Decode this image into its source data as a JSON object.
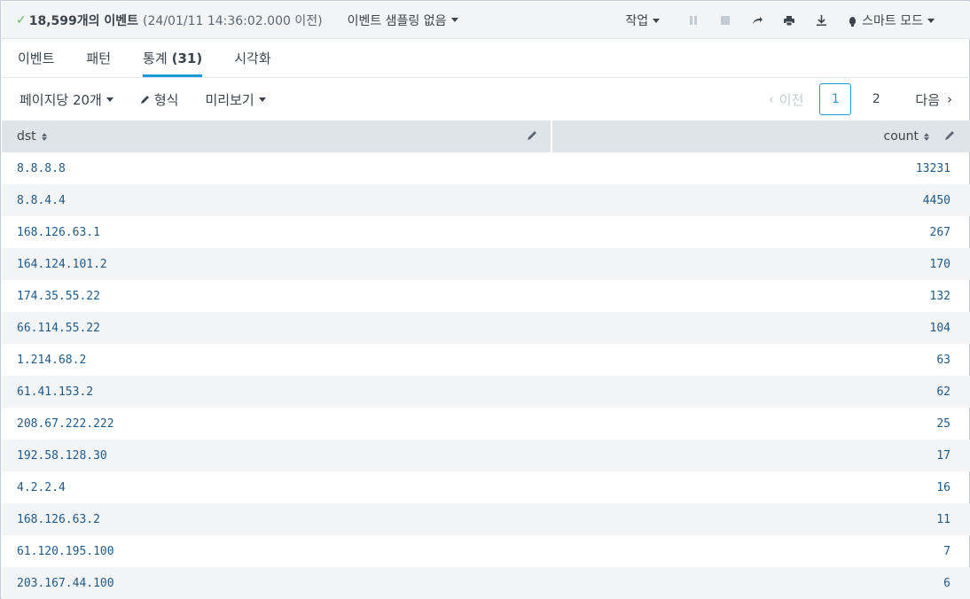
{
  "status": {
    "event_count": "18,599개의 이벤트",
    "timestamp": "(24/01/11 14:36:02.000 이전)",
    "sampling": "이벤트 샘플링 없음",
    "job": "작업",
    "mode": "스마트 모드"
  },
  "tabs": [
    {
      "label": "이벤트",
      "count": ""
    },
    {
      "label": "패턴",
      "count": ""
    },
    {
      "label": "통계",
      "count": "(31)"
    },
    {
      "label": "시각화",
      "count": ""
    }
  ],
  "toolbar": {
    "per_page": "페이지당 20개",
    "format": "형식",
    "preview": "미리보기"
  },
  "pager": {
    "prev": "이전",
    "pages": [
      "1",
      "2"
    ],
    "next": "다음"
  },
  "table": {
    "columns": [
      "dst",
      "count"
    ],
    "rows": [
      [
        "8.8.8.8",
        "13231"
      ],
      [
        "8.8.4.4",
        "4450"
      ],
      [
        "168.126.63.1",
        "267"
      ],
      [
        "164.124.101.2",
        "170"
      ],
      [
        "174.35.55.22",
        "132"
      ],
      [
        "66.114.55.22",
        "104"
      ],
      [
        "1.214.68.2",
        "63"
      ],
      [
        "61.41.153.2",
        "62"
      ],
      [
        "208.67.222.222",
        "25"
      ],
      [
        "192.58.128.30",
        "17"
      ],
      [
        "4.2.2.4",
        "16"
      ],
      [
        "168.126.63.2",
        "11"
      ],
      [
        "61.120.195.100",
        "7"
      ],
      [
        "203.167.44.100",
        "6"
      ]
    ]
  },
  "colors": {
    "accent": "#1a9bd7",
    "check": "#5cc05c",
    "cell_text": "#1e5a8a"
  }
}
